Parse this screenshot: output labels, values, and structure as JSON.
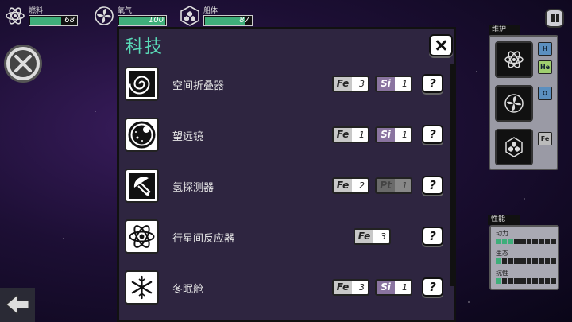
{
  "hud": {
    "fuel": {
      "label": "燃料",
      "value": "68",
      "fraction": 0.68,
      "icon": "atom-icon"
    },
    "oxygen": {
      "label": "氧气",
      "value": "100",
      "fraction": 1.0,
      "icon": "fan-icon"
    },
    "hull": {
      "label": "船体",
      "value": "87",
      "fraction": 0.87,
      "icon": "hull-icon"
    }
  },
  "panel": {
    "title": "科技",
    "items": [
      {
        "name": "空间折叠器",
        "icon": "spiral-icon",
        "costs": [
          {
            "sym": "Fe",
            "num": "3",
            "kind": "fe"
          },
          {
            "sym": "Si",
            "num": "1",
            "kind": "si"
          }
        ]
      },
      {
        "name": "望远镜",
        "icon": "telescope-icon",
        "costs": [
          {
            "sym": "Fe",
            "num": "1",
            "kind": "fe"
          },
          {
            "sym": "Si",
            "num": "1",
            "kind": "si"
          }
        ]
      },
      {
        "name": "氢探测器",
        "icon": "probe-icon",
        "costs": [
          {
            "sym": "Fe",
            "num": "2",
            "kind": "fe"
          },
          {
            "sym": "Pt",
            "num": "1",
            "kind": "pt"
          }
        ]
      },
      {
        "name": "行星间反应器",
        "icon": "atom-icon",
        "costs": [
          {
            "sym": "Fe",
            "num": "3",
            "kind": "fe"
          }
        ]
      },
      {
        "name": "冬眠舱",
        "icon": "snowflake-icon",
        "costs": [
          {
            "sym": "Fe",
            "num": "3",
            "kind": "fe"
          },
          {
            "sym": "Si",
            "num": "1",
            "kind": "si"
          }
        ]
      }
    ],
    "help_label": "?"
  },
  "maintenance": {
    "title": "维护",
    "slots": [
      {
        "icon": "atom-icon",
        "tags": [
          "H",
          "He"
        ]
      },
      {
        "icon": "fan-icon",
        "tags": [
          "O"
        ]
      },
      {
        "icon": "hull-icon",
        "tags": [
          "Fe"
        ]
      }
    ]
  },
  "performance": {
    "title": "性能",
    "stats": [
      {
        "label": "动力",
        "level": 3,
        "max": 10
      },
      {
        "label": "生态",
        "level": 1,
        "max": 10
      },
      {
        "label": "抗性",
        "level": 1,
        "max": 10
      }
    ]
  },
  "colors": {
    "accent": "#59d8b6",
    "bar_fill": "#3fae7a",
    "si_chip": "#8a74a0",
    "fe_chip": "#c8c8c8"
  }
}
